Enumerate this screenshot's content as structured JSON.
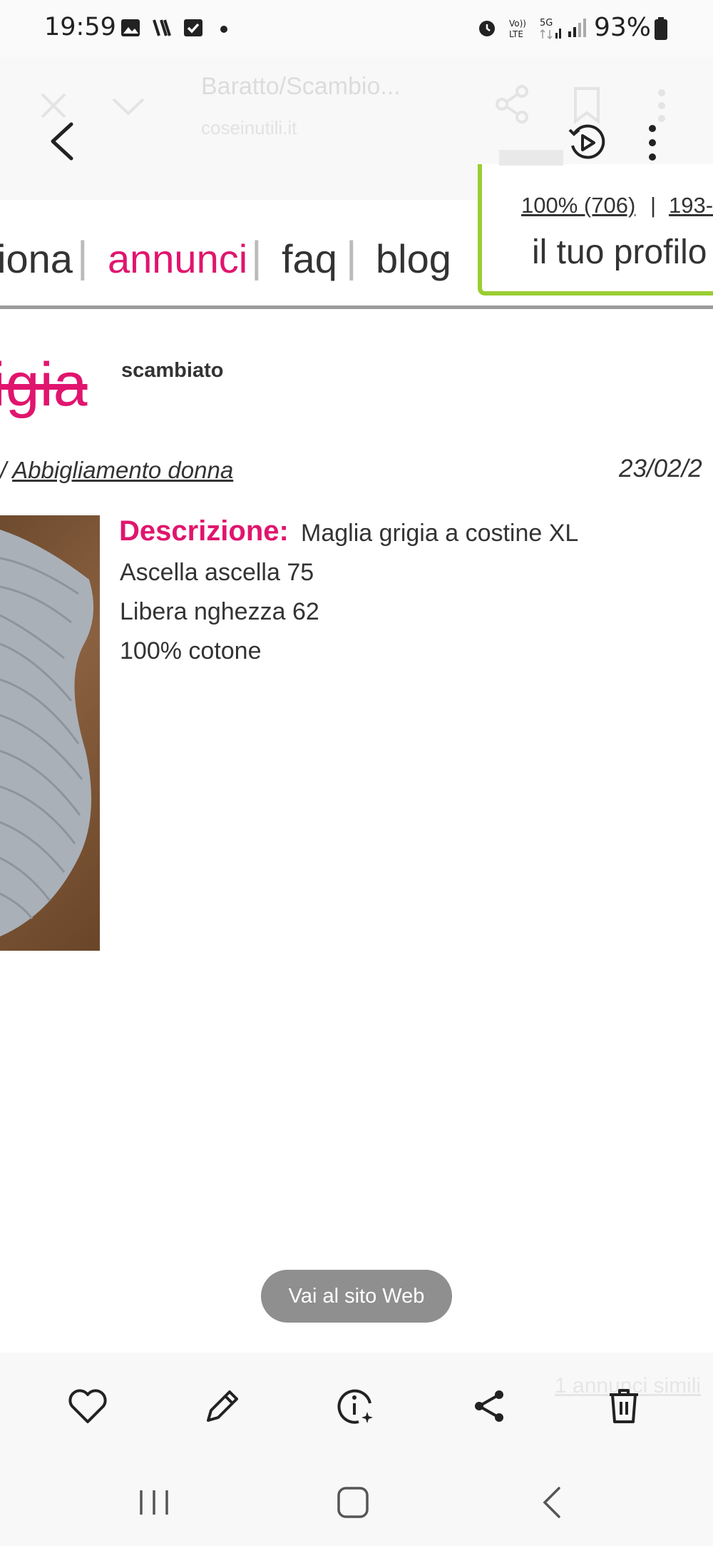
{
  "status": {
    "time": "19:59",
    "battery": "93%"
  },
  "browser_ghost": {
    "title": "Baratto/Scambio...",
    "domain": "coseinutili.it"
  },
  "nav": {
    "items": [
      "iona",
      "annunci",
      "faq",
      "blog"
    ],
    "active": "annunci",
    "profile_stats": "100% (706)",
    "profile_extra": "193-",
    "profile_link": "il tuo profilo"
  },
  "listing": {
    "title": "rigia",
    "status_badge": "scambiato",
    "category_prefix": "/ ",
    "category": "Abbigliamento donna",
    "date": "23/02/2",
    "description_label": "Descrizione:",
    "description_lines": [
      "Maglia grigia a costine XL",
      "Ascella ascella 75",
      "Libera nghezza 62",
      "100% cotone"
    ]
  },
  "floating": {
    "visit_site": "Vai al sito Web"
  },
  "footer_ghost": {
    "similar": "1 annunci simili"
  },
  "icons": {
    "back": "back-arrow-icon",
    "motion_photo": "motion-photo-icon",
    "more": "more-vertical-icon",
    "favorite": "heart-icon",
    "edit": "pencil-icon",
    "info": "info-sparkle-icon",
    "share": "share-icon",
    "delete": "trash-icon"
  },
  "colors": {
    "accent": "#e0156e",
    "profile_border": "#9acd32"
  }
}
